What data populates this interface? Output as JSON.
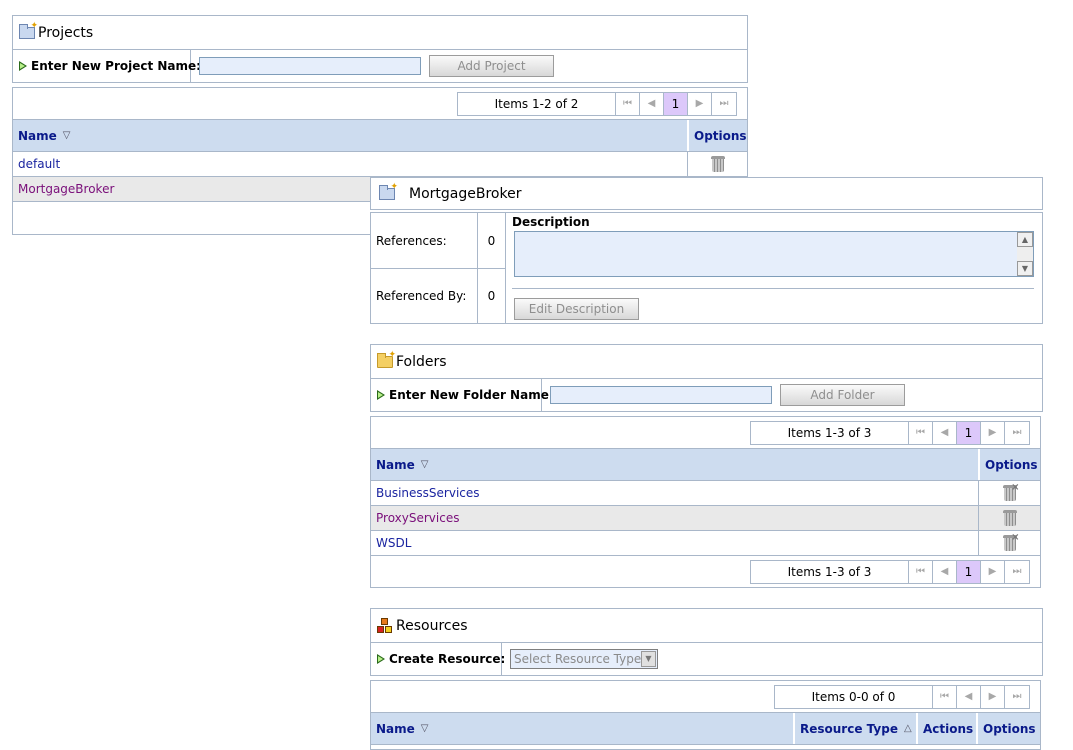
{
  "projects": {
    "title": "Projects",
    "form_label": "Enter New Project Name:",
    "input_value": "",
    "add_button": "Add Project",
    "pager": {
      "info": "Items 1-2 of 2",
      "current_page": "1"
    },
    "columns": [
      "Name",
      "Options"
    ],
    "rows": [
      {
        "name": "default"
      },
      {
        "name": "MortgageBroker"
      }
    ]
  },
  "detail": {
    "title": "MortgageBroker",
    "references_label": "References:",
    "references_value": "0",
    "referenced_by_label": "Referenced By:",
    "referenced_by_value": "0",
    "description_label": "Description",
    "description_value": "",
    "edit_button": "Edit Description"
  },
  "folders": {
    "title": "Folders",
    "form_label": "Enter New Folder Name:",
    "input_value": "",
    "add_button": "Add Folder",
    "pager": {
      "info": "Items 1-3 of 3",
      "current_page": "1"
    },
    "columns": [
      "Name",
      "Options"
    ],
    "rows": [
      {
        "name": "BusinessServices"
      },
      {
        "name": "ProxyServices"
      },
      {
        "name": "WSDL"
      }
    ]
  },
  "resources": {
    "title": "Resources",
    "form_label": "Create Resource:",
    "select_value": "Select Resource Type",
    "pager": {
      "info": "Items 0-0 of 0"
    },
    "columns": [
      "Name",
      "Resource Type",
      "Actions",
      "Options"
    ]
  },
  "icons": {
    "pager_first": "⏮",
    "pager_prev": "◀",
    "pager_next": "▶",
    "pager_last": "⏭",
    "sort_desc": "▽",
    "sort_asc": "△"
  },
  "colors": {
    "header_bg": "#cddcef",
    "link": "#1a24a0",
    "visited_link": "#7a0f7a",
    "current_page_bg": "#dcc8fa",
    "border": "#a9b7c9"
  }
}
